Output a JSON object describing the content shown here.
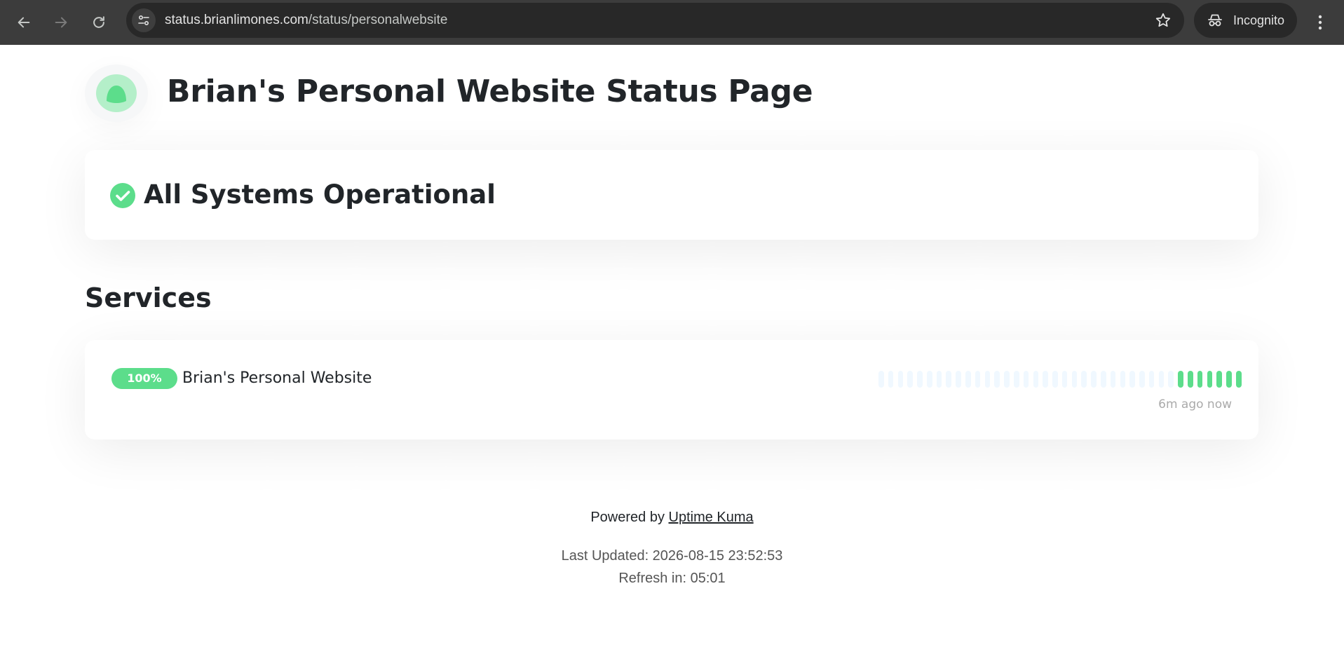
{
  "browser": {
    "url_host": "status.brianlimones.com",
    "url_path": "/status/personalwebsite",
    "profile_label": "Incognito"
  },
  "page": {
    "title": "Brian's Personal Website Status Page",
    "overall_status": "All Systems Operational",
    "status_color": "#5cdd8b",
    "services_heading": "Services"
  },
  "services": [
    {
      "uptime": "100%",
      "name": "Brian's Personal Website",
      "heartbeat_empty": 31,
      "heartbeat_up": 7,
      "time_label": "6m ago now"
    }
  ],
  "footer": {
    "powered_by": "Powered by",
    "powered_link": "Uptime Kuma",
    "last_updated": "Last Updated: 2026-08-15 23:52:53",
    "refresh": "Refresh in: 05:01"
  }
}
